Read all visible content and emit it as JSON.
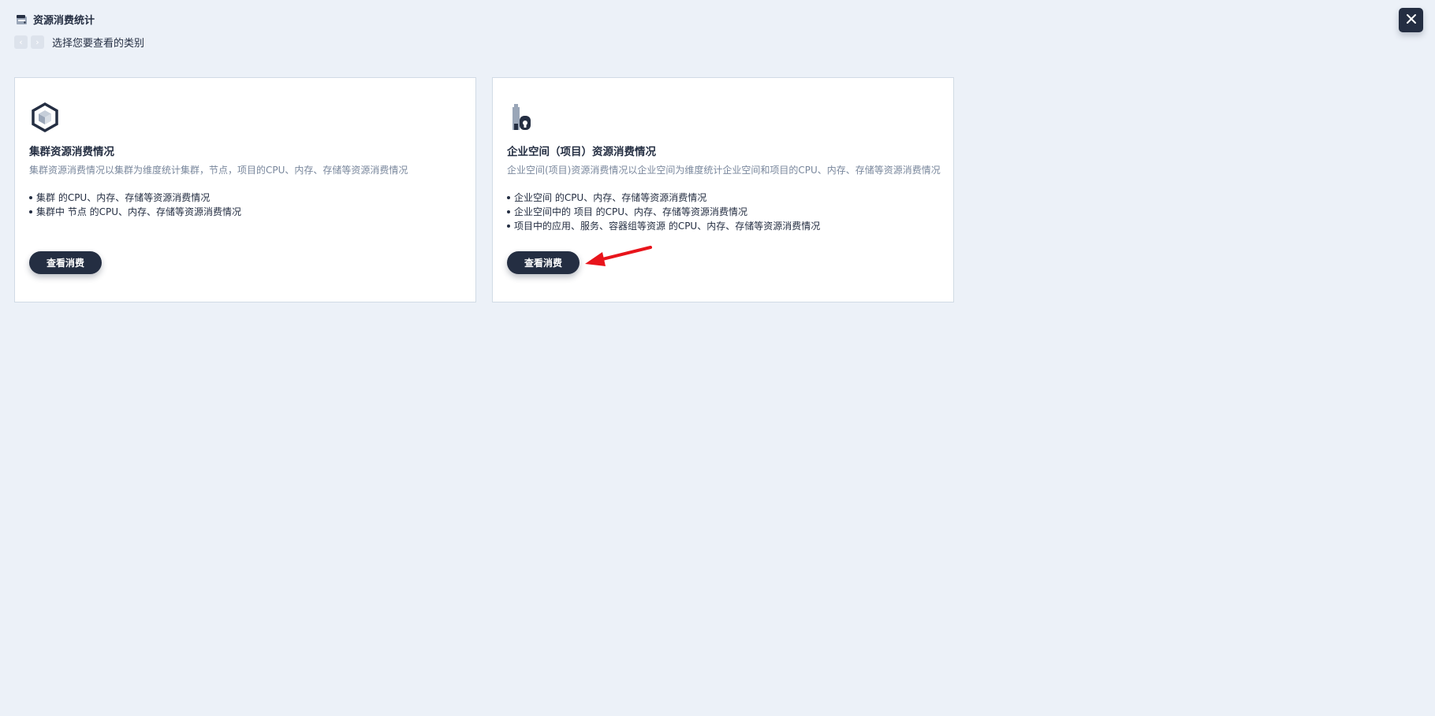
{
  "header": {
    "title": "资源消费统计",
    "app_icon": "ledger-icon"
  },
  "subheader": {
    "text": "选择您要查看的类别",
    "prev_icon": "chevron-left-icon",
    "next_icon": "chevron-right-icon"
  },
  "close_icon": "close-icon",
  "cards": [
    {
      "icon": "cluster-cube-icon",
      "title": "集群资源消费情况",
      "description": "集群资源消费情况以集群为维度统计集群，节点，项目的CPU、内存、存储等资源消费情况",
      "items": [
        "集群 的CPU、内存、存储等资源消费情况",
        "集群中 节点 的CPU、内存、存储等资源消费情况"
      ],
      "button_label": "查看消费"
    },
    {
      "icon": "workspace-building-icon",
      "title": "企业空间（项目）资源消费情况",
      "description": "企业空间(项目)资源消费情况以企业空间为维度统计企业空间和项目的CPU、内存、存储等资源消费情况",
      "items": [
        "企业空间 的CPU、内存、存储等资源消费情况",
        "企业空间中的 项目 的CPU、内存、存储等资源消费情况",
        "项目中的应用、服务、容器组等资源 的CPU、内存、存储等资源消费情况"
      ],
      "button_label": "查看消费"
    }
  ],
  "colors": {
    "background": "#ecf1f8",
    "primary": "#242e42",
    "muted_text": "#79879c",
    "annotation": "#e8141b"
  }
}
